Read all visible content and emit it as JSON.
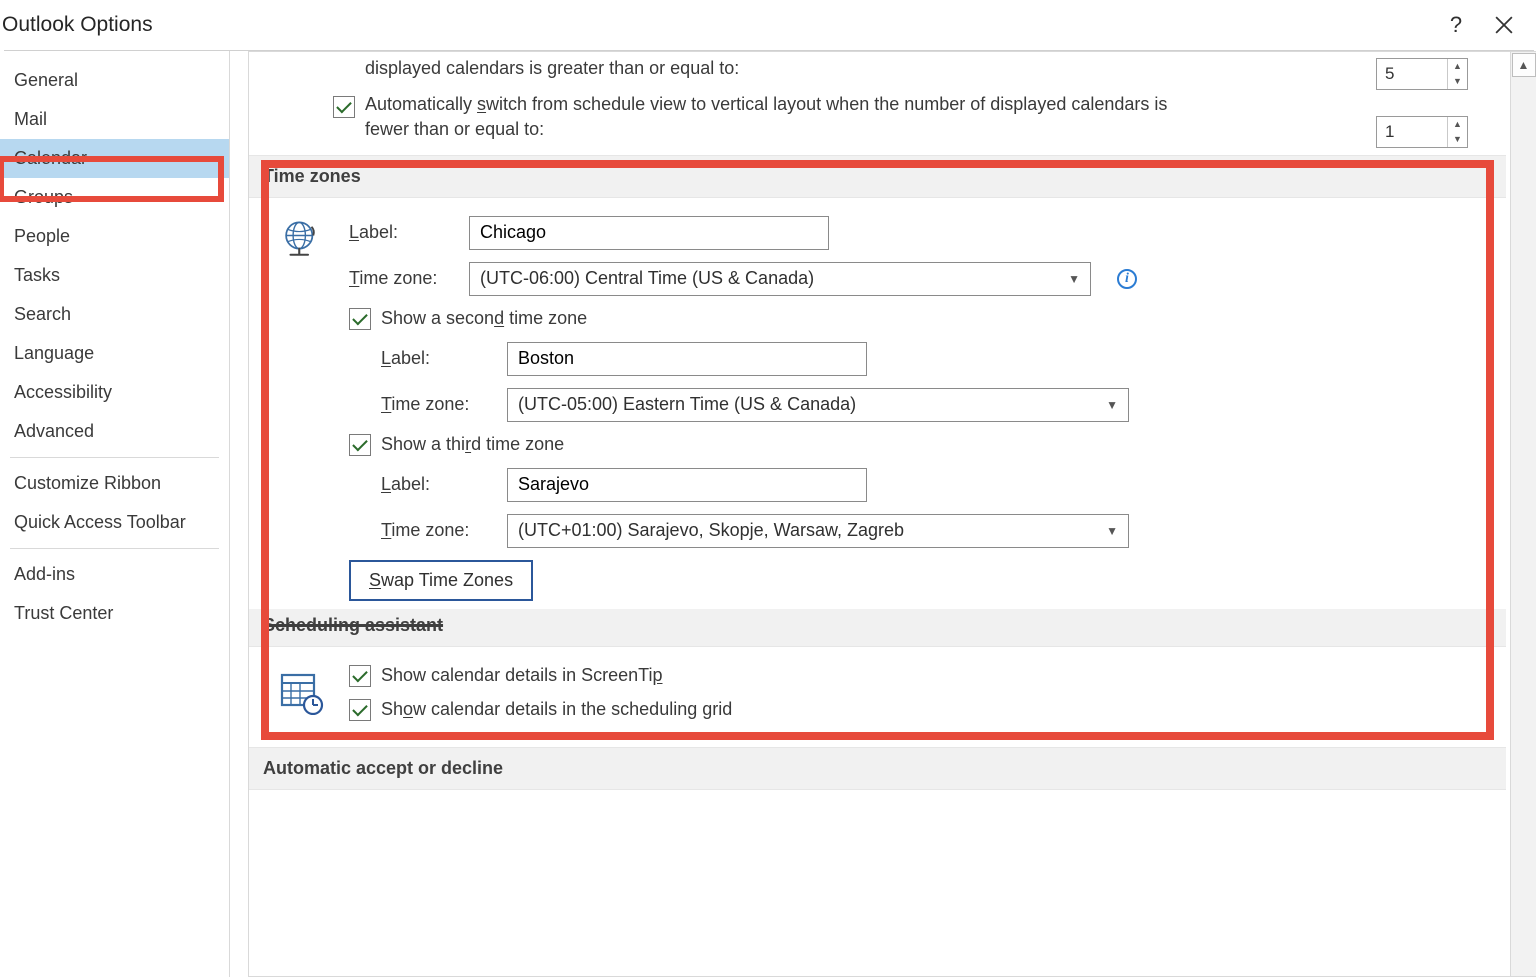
{
  "window": {
    "title": "Outlook Options"
  },
  "sidebar": {
    "items": [
      "General",
      "Mail",
      "Calendar",
      "Groups",
      "People",
      "Tasks",
      "Search",
      "Language",
      "Accessibility",
      "Advanced",
      "Customize Ribbon",
      "Quick Access Toolbar",
      "Add-ins",
      "Trust Center"
    ],
    "selected_index": 2
  },
  "display_settings": {
    "row1_text": "displayed calendars is greater than or equal to:",
    "row1_value": "5",
    "row2_checkbox_text_a": "Automatically ",
    "row2_checkbox_text_uline": "s",
    "row2_checkbox_text_b": "witch from schedule view to vertical layout when the number of displayed calendars is fewer than or equal to:",
    "row2_value": "1"
  },
  "timezones": {
    "heading": "Time zones",
    "label_caption": "Label:",
    "tz_caption_pre": "T",
    "tz_caption_post": "ime zone:",
    "primary_label": "Chicago",
    "primary_tz": "(UTC-06:00) Central Time (US & Canada)",
    "show_second_a": "Show a secon",
    "show_second_u": "d",
    "show_second_b": " time zone",
    "second_label": "Boston",
    "second_tz": "(UTC-05:00) Eastern Time (US & Canada)",
    "show_third_a": "Show a thi",
    "show_third_u": "r",
    "show_third_b": "d time zone",
    "third_label": "Sarajevo",
    "third_tz": "(UTC+01:00) Sarajevo, Skopje, Warsaw, Zagreb",
    "swap_btn_u": "S",
    "swap_btn_rest": "wap Time Zones"
  },
  "scheduling": {
    "heading": "Scheduling assistant",
    "screentip_a": "Show calendar details in ScreenTi",
    "screentip_u": "p",
    "grid_a": "Sh",
    "grid_u": "o",
    "grid_b": "w calendar details in the scheduling grid"
  },
  "auto": {
    "heading": "Automatic accept or decline"
  }
}
